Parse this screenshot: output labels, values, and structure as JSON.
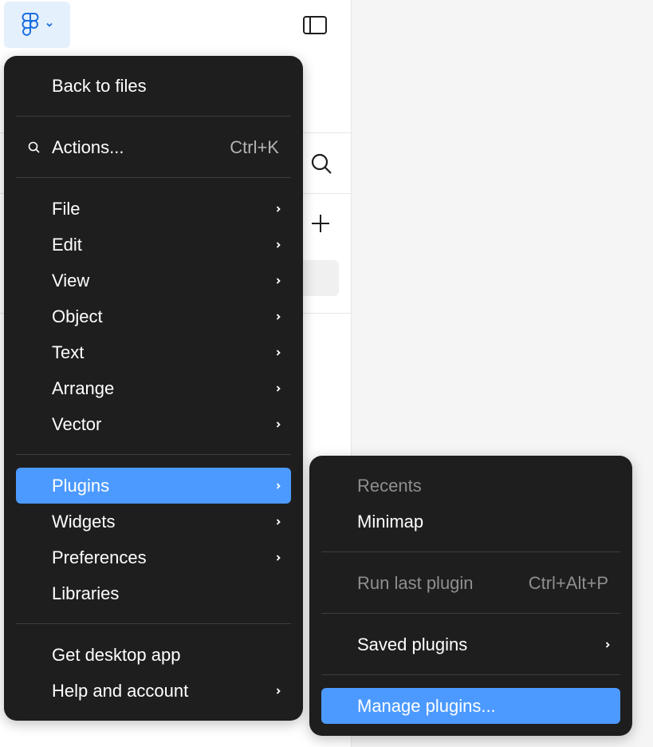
{
  "colors": {
    "menu_bg": "#1e1e1e",
    "highlight": "#4c9aff",
    "disabled_text": "#8f8f8f",
    "logo_button_bg": "#e5f0fd"
  },
  "toolbar": {
    "logo_icon": "figma-logo-icon",
    "dropdown_icon": "chevron-down-icon",
    "sidebar_toggle_icon": "sidebar-toggle-icon",
    "search_icon": "search-icon",
    "add_icon": "plus-icon"
  },
  "main_menu": {
    "back": "Back to files",
    "actions": {
      "label": "Actions...",
      "shortcut": "Ctrl+K"
    },
    "items": [
      {
        "label": "File"
      },
      {
        "label": "Edit"
      },
      {
        "label": "View"
      },
      {
        "label": "Object"
      },
      {
        "label": "Text"
      },
      {
        "label": "Arrange"
      },
      {
        "label": "Vector"
      }
    ],
    "plugins": "Plugins",
    "widgets": "Widgets",
    "preferences": "Preferences",
    "libraries": "Libraries",
    "desktop_app": "Get desktop app",
    "help": "Help and account"
  },
  "plugins_submenu": {
    "recents_label": "Recents",
    "recent_items": [
      "Minimap"
    ],
    "run_last": {
      "label": "Run last plugin",
      "shortcut": "Ctrl+Alt+P"
    },
    "saved": "Saved plugins",
    "manage": "Manage plugins..."
  }
}
